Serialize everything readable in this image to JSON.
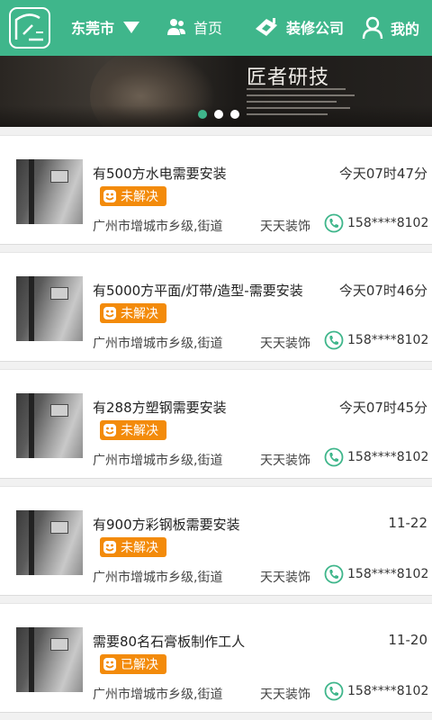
{
  "header": {
    "city": "东莞市",
    "nav": [
      {
        "label": "首页",
        "icon": "users-icon"
      },
      {
        "label": "装修公司",
        "icon": "company-icon"
      },
      {
        "label": "我的",
        "icon": "user-icon"
      }
    ]
  },
  "banner": {
    "title": "匠者研技",
    "slide_count": 3,
    "active_slide": 1
  },
  "items": [
    {
      "title": "有500方水电需要安装",
      "time": "今天07时47分",
      "status": "未解决",
      "address": "广州市增城市乡级,街道",
      "company": "天天装饰",
      "phone": "158****8102"
    },
    {
      "title": "有5000方平面/灯带/造型-需要安装",
      "time": "今天07时46分",
      "status": "未解决",
      "address": "广州市增城市乡级,街道",
      "company": "天天装饰",
      "phone": "158****8102"
    },
    {
      "title": "有288方塑钢需要安装",
      "time": "今天07时45分",
      "status": "未解决",
      "address": "广州市增城市乡级,街道",
      "company": "天天装饰",
      "phone": "158****8102"
    },
    {
      "title": "有900方彩钢板需要安装",
      "time": "11-22",
      "status": "未解决",
      "address": "广州市增城市乡级,街道",
      "company": "天天装饰",
      "phone": "158****8102"
    },
    {
      "title": "需要80名石膏板制作工人",
      "time": "11-20",
      "status": "已解决",
      "address": "广州市增城市乡级,街道",
      "company": "天天装饰",
      "phone": "158****8102"
    }
  ],
  "colors": {
    "brand": "#3fb68b",
    "badge": "#f38b0b",
    "phone": "#3fb68b"
  }
}
